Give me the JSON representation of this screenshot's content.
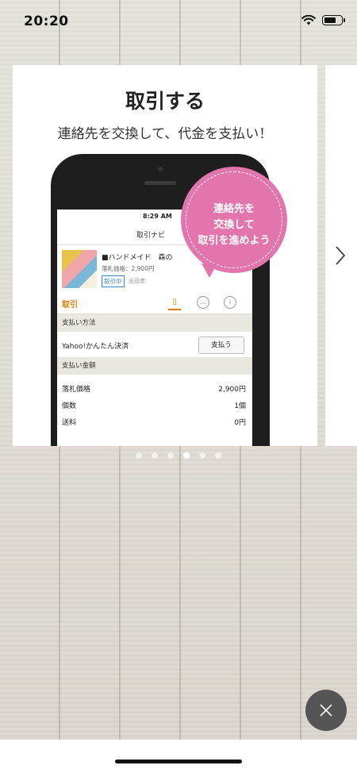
{
  "status_bar": {
    "time": "20:20"
  },
  "card": {
    "title": "取引する",
    "subtitle": "連絡先を交換して、代金を支払い！",
    "bubble_lines": [
      "連絡先を",
      "交換して",
      "取引を進めよう"
    ],
    "phone": {
      "status_left": "●●●●● ",
      "status_time": "8:29 AM",
      "nav_title": "取引ナビ",
      "item": {
        "name": "■ハンドメイド　森の",
        "price": "落札価格：2,900円",
        "badge": "取引中",
        "seller": "出品者:"
      },
      "tab_label": "取引",
      "payment_section": "支払い方法",
      "payment_method": "Yahoo!かんたん決済",
      "pay_button": "支払う",
      "amount_section": "支払い金額",
      "amounts": [
        {
          "label": "落札価格",
          "value": "2,900円"
        },
        {
          "label": "個数",
          "value": "1個"
        },
        {
          "label": "送料",
          "value": "0円"
        }
      ]
    }
  },
  "pagination": {
    "count": 6,
    "active_index": 3
  },
  "colors": {
    "accent_pink": "#e275ab",
    "accent_orange": "#e07a00",
    "close_bg": "#555555"
  },
  "icons": {
    "wifi": "wifi-icon",
    "battery": "battery-icon",
    "next": "chevron-right-icon",
    "close": "close-icon"
  }
}
